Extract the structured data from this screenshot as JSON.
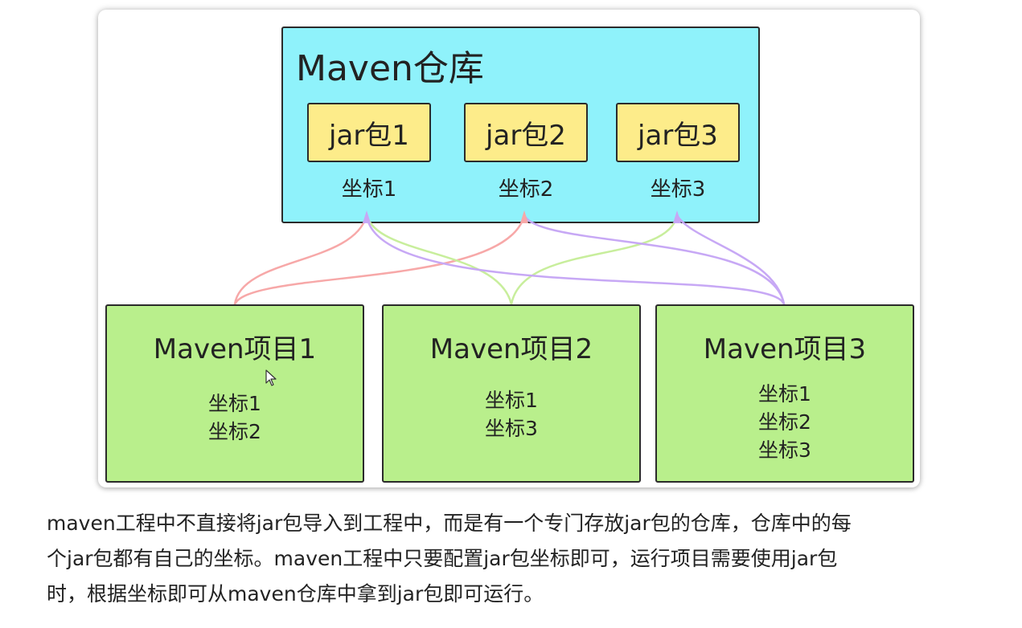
{
  "repository": {
    "title": "Maven仓库",
    "jars": [
      {
        "label": "jar包1",
        "coord": "坐标1"
      },
      {
        "label": "jar包2",
        "coord": "坐标2"
      },
      {
        "label": "jar包3",
        "coord": "坐标3"
      }
    ],
    "color": "#8ff2fb",
    "jar_color": "#fdec8a"
  },
  "projects": [
    {
      "title": "Maven项目1",
      "coords": [
        "坐标1",
        "坐标2"
      ]
    },
    {
      "title": "Maven项目2",
      "coords": [
        "坐标1",
        "坐标3"
      ]
    },
    {
      "title": "Maven项目3",
      "coords": [
        "坐标1",
        "坐标2",
        "坐标3"
      ]
    }
  ],
  "project_color": "#b9ef8c",
  "links": [
    {
      "from": "Maven项目1",
      "to": "jar包1",
      "color": "#f7a8a8"
    },
    {
      "from": "Maven项目1",
      "to": "jar包2",
      "color": "#f7a8a8"
    },
    {
      "from": "Maven项目2",
      "to": "jar包1",
      "color": "#c8ee9c"
    },
    {
      "from": "Maven项目2",
      "to": "jar包3",
      "color": "#c8ee9c"
    },
    {
      "from": "Maven项目3",
      "to": "jar包1",
      "color": "#c7a8f5"
    },
    {
      "from": "Maven项目3",
      "to": "jar包2",
      "color": "#c7a8f5"
    },
    {
      "from": "Maven项目3",
      "to": "jar包3",
      "color": "#c7a8f5"
    }
  ],
  "caption": {
    "lines": [
      "maven工程中不直接将jar包导入到工程中，而是有一个专门存放jar包的仓库，仓库中的每",
      "个jar包都有自己的坐标。maven工程中只要配置jar包坐标即可，运行项目需要使用jar包",
      "时，根据坐标即可从maven仓库中拿到jar包即可运行。"
    ]
  }
}
